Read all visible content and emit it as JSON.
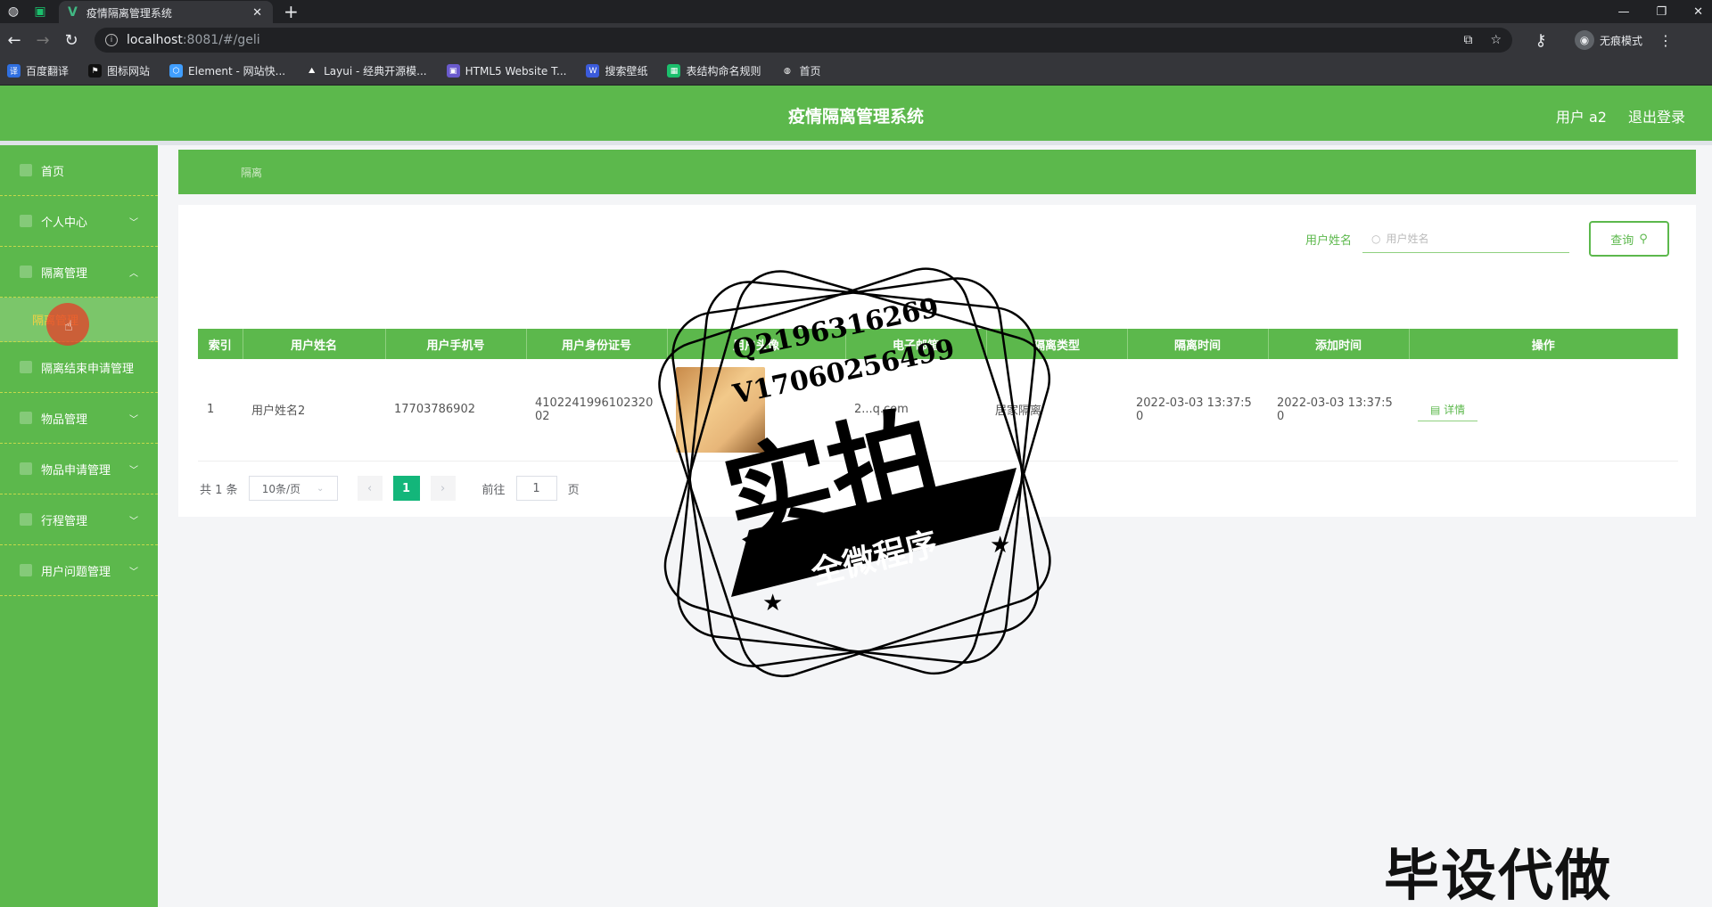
{
  "browser": {
    "tab_title": "疫情隔离管理系统",
    "url_host": "localhost",
    "url_path": ":8081/#/geli",
    "profile_label": "无痕模式",
    "bookmarks": [
      "百度翻译",
      "图标网站",
      "Element - 网站快...",
      "Layui - 经典开源模...",
      "HTML5 Website T...",
      "搜索壁纸",
      "表结构命名规则",
      "首页"
    ]
  },
  "header": {
    "title": "疫情隔离管理系统",
    "user": "用户 a2",
    "logout": "退出登录"
  },
  "sidebar": {
    "items": [
      {
        "label": "首页"
      },
      {
        "label": "个人中心"
      },
      {
        "label": "隔离管理"
      },
      {
        "label": "隔离管理"
      },
      {
        "label": "隔离结束申请管理"
      },
      {
        "label": "物品管理"
      },
      {
        "label": "物品申请管理"
      },
      {
        "label": "行程管理"
      },
      {
        "label": "用户问题管理"
      }
    ]
  },
  "breadcrumb": {
    "label": "隔离"
  },
  "search": {
    "label": "用户姓名",
    "placeholder": "用户姓名",
    "button": "查询"
  },
  "table": {
    "headers": [
      "索引",
      "用户姓名",
      "用户手机号",
      "用户身份证号",
      "用户头像",
      "电子邮箱",
      "隔离类型",
      "隔离时间",
      "添加时间",
      "操作"
    ],
    "rows": [
      {
        "index": "1",
        "name": "用户姓名2",
        "phone": "17703786902",
        "id_card": "410224199610232002",
        "email": "2...q.com",
        "type": "居家隔离",
        "isolate_time": "2022-03-03 13:37:50",
        "add_time": "2022-03-03 13:37:50",
        "action": "详情"
      }
    ]
  },
  "pager": {
    "total": "共 1 条",
    "page_size": "10条/页",
    "current": "1",
    "goto_label": "前往",
    "goto_value": "1",
    "page_suffix": "页"
  },
  "watermark": {
    "qq": "Q2196316269",
    "vx": "V17060256499",
    "main": "实拍",
    "ribbon": "全微程序",
    "corner": "毕设代做"
  }
}
